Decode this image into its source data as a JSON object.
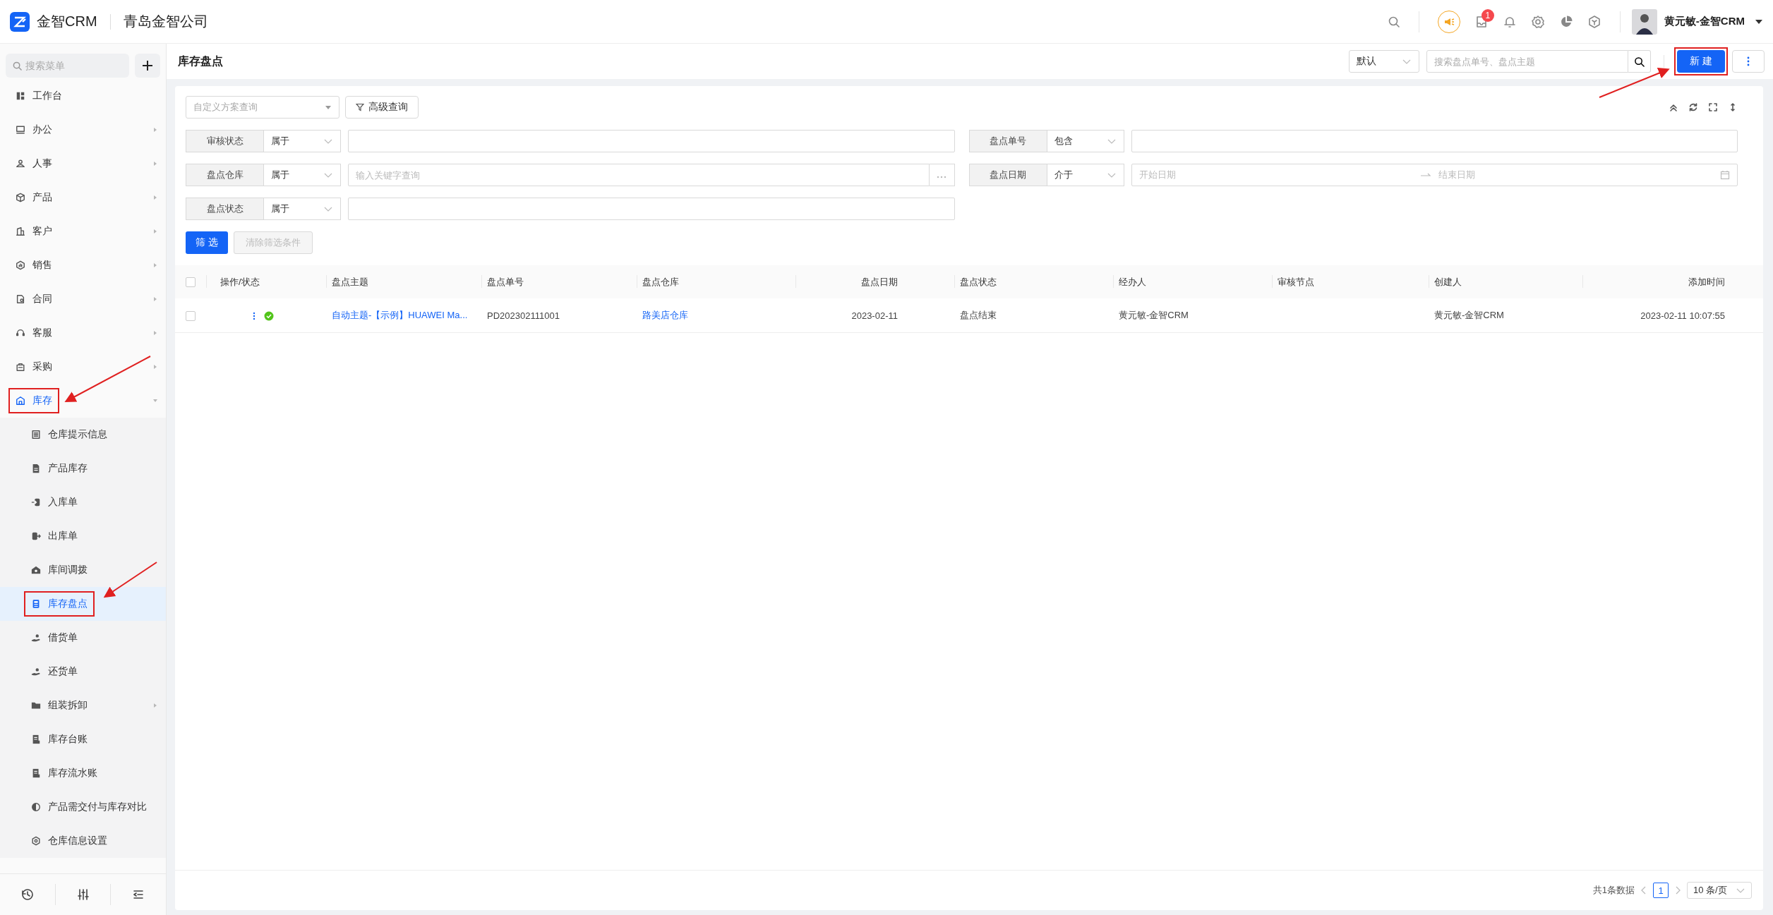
{
  "header": {
    "logo": "金智CRM",
    "company": "青岛金智公司",
    "notification_count": "1",
    "user": "黄元敏-金智CRM"
  },
  "sidebar": {
    "search_placeholder": "搜索菜单",
    "items": [
      {
        "label": "工作台",
        "has_children": false,
        "expanded": false,
        "selected": false,
        "highlighted": false
      },
      {
        "label": "办公",
        "has_children": true,
        "expanded": false,
        "selected": false,
        "highlighted": false
      },
      {
        "label": "人事",
        "has_children": true,
        "expanded": false,
        "selected": false,
        "highlighted": false
      },
      {
        "label": "产品",
        "has_children": true,
        "expanded": false,
        "selected": false,
        "highlighted": false
      },
      {
        "label": "客户",
        "has_children": true,
        "expanded": false,
        "selected": false,
        "highlighted": false
      },
      {
        "label": "销售",
        "has_children": true,
        "expanded": false,
        "selected": false,
        "highlighted": false
      },
      {
        "label": "合同",
        "has_children": true,
        "expanded": false,
        "selected": false,
        "highlighted": false
      },
      {
        "label": "客服",
        "has_children": true,
        "expanded": false,
        "selected": false,
        "highlighted": false
      },
      {
        "label": "采购",
        "has_children": true,
        "expanded": false,
        "selected": false,
        "highlighted": false
      },
      {
        "label": "库存",
        "has_children": true,
        "expanded": true,
        "selected": false,
        "highlighted": true,
        "children": [
          {
            "label": "仓库提示信息",
            "has_children": false,
            "selected": false,
            "highlighted": false
          },
          {
            "label": "产品库存",
            "has_children": false,
            "selected": false,
            "highlighted": false
          },
          {
            "label": "入库单",
            "has_children": false,
            "selected": false,
            "highlighted": false
          },
          {
            "label": "出库单",
            "has_children": false,
            "selected": false,
            "highlighted": false
          },
          {
            "label": "库间调拨",
            "has_children": false,
            "selected": false,
            "highlighted": false
          },
          {
            "label": "库存盘点",
            "has_children": false,
            "selected": true,
            "highlighted": true
          },
          {
            "label": "借货单",
            "has_children": false,
            "selected": false,
            "highlighted": false
          },
          {
            "label": "还货单",
            "has_children": false,
            "selected": false,
            "highlighted": false
          },
          {
            "label": "组装拆卸",
            "has_children": true,
            "selected": false,
            "highlighted": false
          },
          {
            "label": "库存台账",
            "has_children": false,
            "selected": false,
            "highlighted": false
          },
          {
            "label": "库存流水账",
            "has_children": false,
            "selected": false,
            "highlighted": false
          },
          {
            "label": "产品需交付与库存对比",
            "has_children": false,
            "selected": false,
            "highlighted": false
          },
          {
            "label": "仓库信息设置",
            "has_children": false,
            "selected": false,
            "highlighted": false
          }
        ]
      }
    ]
  },
  "page": {
    "title": "库存盘点",
    "view_select": "默认",
    "search_placeholder": "搜索盘点单号、盘点主题",
    "new_button": "新 建",
    "new_button_highlighted": true
  },
  "filters": {
    "scheme_placeholder": "自定义方案查询",
    "advanced_button": "高级查询",
    "conditions": [
      {
        "field": "审核状态",
        "operator": "属于",
        "kind": "text"
      },
      {
        "field": "盘点单号",
        "operator": "包含",
        "kind": "text"
      },
      {
        "field": "盘点仓库",
        "operator": "属于",
        "kind": "lookup",
        "placeholder": "输入关键字查询"
      },
      {
        "field": "盘点日期",
        "operator": "介于",
        "kind": "date_range",
        "start_placeholder": "开始日期",
        "end_placeholder": "结束日期"
      },
      {
        "field": "盘点状态",
        "operator": "属于",
        "kind": "text"
      }
    ],
    "filter_button": "筛 选",
    "clear_button": "清除筛选条件",
    "clear_disabled": true
  },
  "table": {
    "select_all": false,
    "columns": [
      "操作/状态",
      "盘点主题",
      "盘点单号",
      "盘点仓库",
      "盘点日期",
      "盘点状态",
      "经办人",
      "审核节点",
      "创建人",
      "添加时间"
    ],
    "rows": [
      {
        "selected": false,
        "approved": true,
        "cells": [
          {
            "text": ""
          },
          {
            "text": "自动主题-【示例】HUAWEI Ma...",
            "link": true
          },
          {
            "text": "PD202302111001",
            "link": false
          },
          {
            "text": "路美店仓库",
            "link": true
          },
          {
            "text": "2023-02-11",
            "link": false
          },
          {
            "text": "盘点结束",
            "link": false
          },
          {
            "text": "黄元敏-金智CRM",
            "link": false
          },
          {
            "text": ""
          },
          {
            "text": "黄元敏-金智CRM",
            "link": false
          },
          {
            "text": "2023-02-11 10:07:55",
            "link": false
          }
        ]
      }
    ]
  },
  "pagination": {
    "total": "共1条数据",
    "pages": [
      {
        "label": "1",
        "selected": true
      }
    ],
    "page_size": "10 条/页"
  }
}
